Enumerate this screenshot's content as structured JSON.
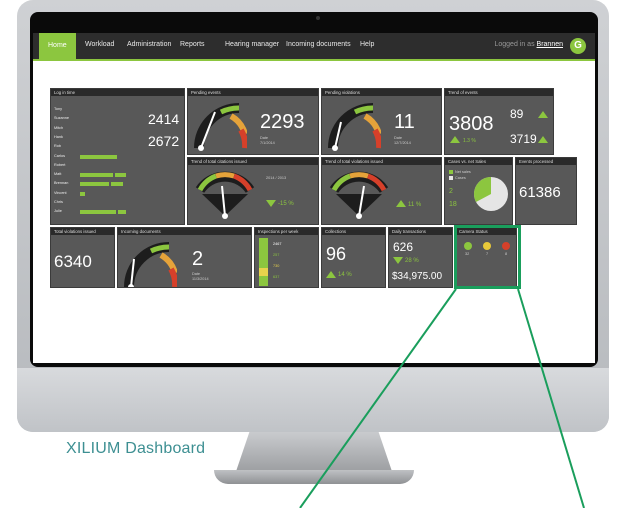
{
  "nav": {
    "items": [
      "Home",
      "Workload",
      "Administration",
      "Reports",
      "Hearing manager",
      "Incoming documents",
      "Help"
    ],
    "login_prefix": "Logged in as",
    "user": "Brannen",
    "logo_letter": "G"
  },
  "tiles": {
    "log_in_time": {
      "title": "Log in time",
      "names": [
        "Tony",
        "Suzanne",
        "Mitch",
        "Hank",
        "Rob",
        "Carlos",
        "Robert",
        "Matt",
        "Brennan",
        "Vincent",
        "Chris",
        "Julie"
      ],
      "value1": "2414",
      "value2": "2672"
    },
    "pending_events": {
      "title": "Pending events",
      "value": "2293",
      "sub": "Date",
      "date": "7/1/2014"
    },
    "pending_violations": {
      "title": "Pending violations",
      "value": "11",
      "sub": "Date",
      "date": "12/7/2014"
    },
    "trend_of_events": {
      "title": "Trend of events",
      "value": "3808",
      "pct": "1.3 %",
      "right_value1": "89",
      "right_value2": "3719"
    },
    "trend_citations": {
      "title": "Trend of total citations issued",
      "pct": "-15 %"
    },
    "trend_violations": {
      "title": "Trend of total violations issued",
      "pct": "11 %"
    },
    "cases_vs_sales": {
      "title": "Cases vs. net Sales",
      "legend": [
        "Net sales",
        "Cases"
      ],
      "v1": "2",
      "v2": "18"
    },
    "events_processed": {
      "title": "Events processed",
      "value": "61386"
    },
    "total_violations": {
      "title": "Total violations issued",
      "value": "6340"
    },
    "incoming_documents": {
      "title": "Incoming documents",
      "value": "2",
      "sub": "Date",
      "date": "11/3/2014"
    },
    "inspections_per_week": {
      "title": "Inspections per week",
      "values": [
        "2467",
        "257",
        "730",
        "637"
      ]
    },
    "collections": {
      "title": "Collections",
      "value": "96",
      "pct": "14 %"
    },
    "daily_transactions": {
      "title": "Daily transactions",
      "value": "626",
      "pct": "28 %",
      "amount": "$34,975.00"
    },
    "camera_status": {
      "title": "Camera Status",
      "counts": [
        "32",
        "7",
        "8"
      ]
    }
  },
  "colors": {
    "accent": "#8cc63f",
    "tile_bg": "#585858",
    "highlight": "#1a9e5c",
    "caption": "#3d8f92"
  },
  "caption": "XILIUM Dashboard"
}
